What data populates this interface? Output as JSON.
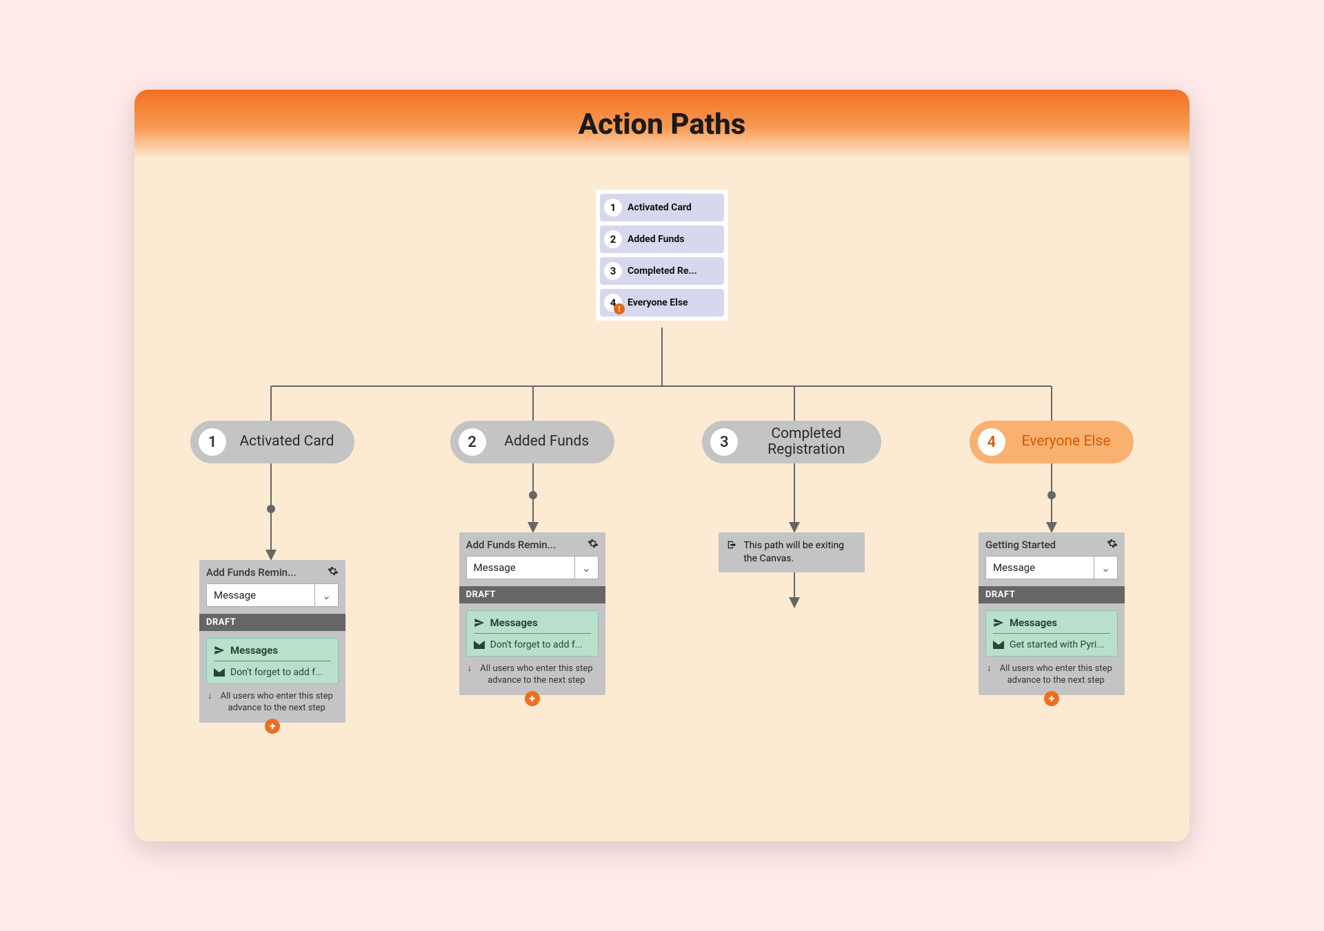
{
  "header": {
    "title": "Action Paths"
  },
  "source": {
    "rows": [
      {
        "num": "1",
        "label": "Activated Card",
        "warn": false
      },
      {
        "num": "2",
        "label": "Added Funds",
        "warn": false
      },
      {
        "num": "3",
        "label": "Completed Re...",
        "warn": false
      },
      {
        "num": "4",
        "label": "Everyone Else",
        "warn": true
      }
    ],
    "warn_glyph": "!"
  },
  "paths": [
    {
      "num": "1",
      "label": "Activated Card",
      "active": false,
      "type": "step",
      "card": {
        "title": "Add Funds Remin...",
        "select": "Message",
        "draft": "DRAFT",
        "messages_label": "Messages",
        "message_text": "Don't forget to add f...",
        "advance": "All users who enter this step advance to the next step"
      }
    },
    {
      "num": "2",
      "label": "Added Funds",
      "active": false,
      "type": "step",
      "card": {
        "title": "Add Funds Remin...",
        "select": "Message",
        "draft": "DRAFT",
        "messages_label": "Messages",
        "message_text": "Don't forget to add f...",
        "advance": "All users who enter this step advance to the next step"
      }
    },
    {
      "num": "3",
      "label": "Completed Registration",
      "active": false,
      "type": "exit",
      "exit_text": "This path will be exiting the Canvas."
    },
    {
      "num": "4",
      "label": "Everyone Else",
      "active": true,
      "type": "step",
      "card": {
        "title": "Getting Started",
        "select": "Message",
        "draft": "DRAFT",
        "messages_label": "Messages",
        "message_text": "Get started with Pyri...",
        "advance": "All users who enter this step advance to the next step"
      }
    }
  ],
  "icons": {
    "chevron_down": "⌄",
    "arrow_down": "↓"
  }
}
